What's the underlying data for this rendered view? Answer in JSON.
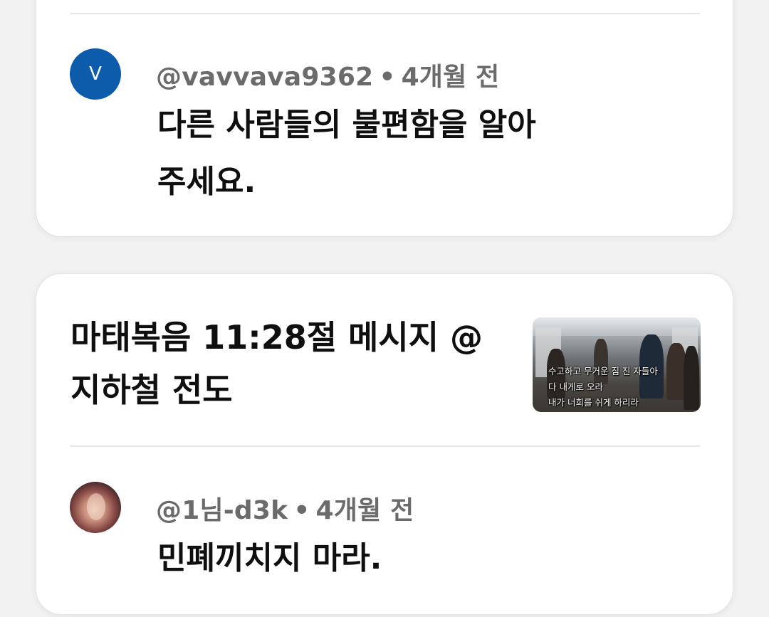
{
  "comments": [
    {
      "avatar_letter": "V",
      "avatar_color": "#0d5bab",
      "handle": "@vavvava9362",
      "separator": "•",
      "time": "4개월 전",
      "text": "다른 사람들의 불편함을 알아주세요."
    },
    {
      "avatar_letter": "",
      "handle": "@1님-d3k",
      "separator": "•",
      "time": "4개월 전",
      "text": "민폐끼치지 마라."
    }
  ],
  "video": {
    "title": "마태복음 11:28절 메시지 @지하철 전도",
    "thumbnail_caption": [
      "수고하고 무거운 짐 진 자들아",
      "다 내게로 오라",
      "내가 너희를 쉬게 하리라"
    ]
  }
}
